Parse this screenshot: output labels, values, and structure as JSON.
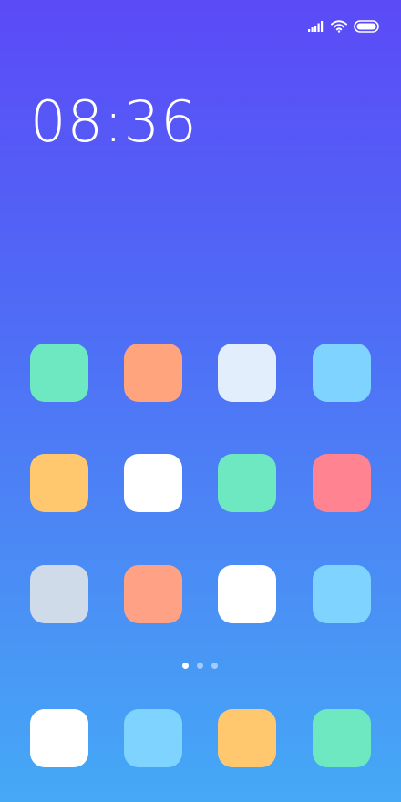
{
  "status_bar": {
    "icons": [
      "cellular-signal-icon",
      "wifi-icon",
      "battery-icon"
    ]
  },
  "clock": {
    "time": "08:36"
  },
  "home_grid": {
    "rows": [
      [
        {
          "name": "app-icon-1",
          "color": "#6de8c0"
        },
        {
          "name": "app-icon-2",
          "color": "#ffa47c"
        },
        {
          "name": "app-icon-3",
          "color": "#e3eefc"
        },
        {
          "name": "app-icon-4",
          "color": "#7fd4ff"
        }
      ],
      [
        {
          "name": "app-icon-5",
          "color": "#ffc86e"
        },
        {
          "name": "app-icon-6",
          "color": "#ffffff"
        },
        {
          "name": "app-icon-7",
          "color": "#6de8c0"
        },
        {
          "name": "app-icon-8",
          "color": "#ff8391"
        }
      ],
      [
        {
          "name": "app-icon-9",
          "color": "#cfdbe8"
        },
        {
          "name": "app-icon-10",
          "color": "#ffa184"
        },
        {
          "name": "app-icon-11",
          "color": "#ffffff"
        },
        {
          "name": "app-icon-12",
          "color": "#7fd4ff"
        }
      ]
    ]
  },
  "page_indicator": {
    "pages": 3,
    "current": 1
  },
  "dock": {
    "apps": [
      {
        "name": "dock-app-1",
        "color": "#ffffff"
      },
      {
        "name": "dock-app-2",
        "color": "#7fd4ff"
      },
      {
        "name": "dock-app-3",
        "color": "#ffc86e"
      },
      {
        "name": "dock-app-4",
        "color": "#6de8c0"
      }
    ]
  }
}
